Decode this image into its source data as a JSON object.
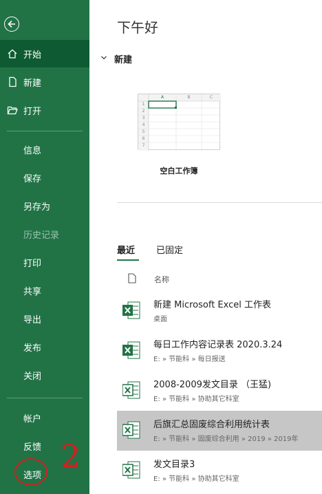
{
  "sidebar": {
    "back_icon": "back-arrow-icon",
    "items": [
      {
        "label": "开始",
        "icon": "home-icon"
      },
      {
        "label": "新建",
        "icon": "new-doc-icon"
      },
      {
        "label": "打开",
        "icon": "open-folder-icon"
      },
      {
        "label": "信息"
      },
      {
        "label": "保存"
      },
      {
        "label": "另存为"
      },
      {
        "label": "历史记录"
      },
      {
        "label": "打印"
      },
      {
        "label": "共享"
      },
      {
        "label": "导出"
      },
      {
        "label": "发布"
      },
      {
        "label": "关闭"
      },
      {
        "label": "帐户"
      },
      {
        "label": "反馈"
      },
      {
        "label": "选项"
      }
    ]
  },
  "main": {
    "greeting": "下午好",
    "new_section": {
      "label": "新建"
    },
    "template": {
      "label": "空白工作簿",
      "col_headers": [
        "A",
        "B",
        "C"
      ],
      "row_headers": [
        "1",
        "2",
        "3",
        "4",
        "5",
        "6",
        "7"
      ]
    },
    "tabs": [
      {
        "label": "最近"
      },
      {
        "label": "已固定"
      }
    ],
    "list_header": {
      "name_col": "名称"
    },
    "files": [
      {
        "name": "新建 Microsoft Excel 工作表",
        "path": "桌面"
      },
      {
        "name": "每日工作内容记录表 2020.3.24",
        "path": "E: » 节能科 » 每日报送"
      },
      {
        "name": "2008-2009发文目录 （王猛)",
        "path": "E: » 节能科 » 协助其它科室"
      },
      {
        "name": "后旗汇总固废综合利用统计表",
        "path": "E: » 节能科 » 固废综合利用 » 2019 » 2019年"
      },
      {
        "name": "发文目录3",
        "path": "E: » 节能科 » 协助其它科室"
      }
    ]
  },
  "annotation": {
    "number": "2"
  },
  "colors": {
    "accent": "#217346",
    "selected_row": "#c6c6c6",
    "annotation": "#d42020"
  }
}
